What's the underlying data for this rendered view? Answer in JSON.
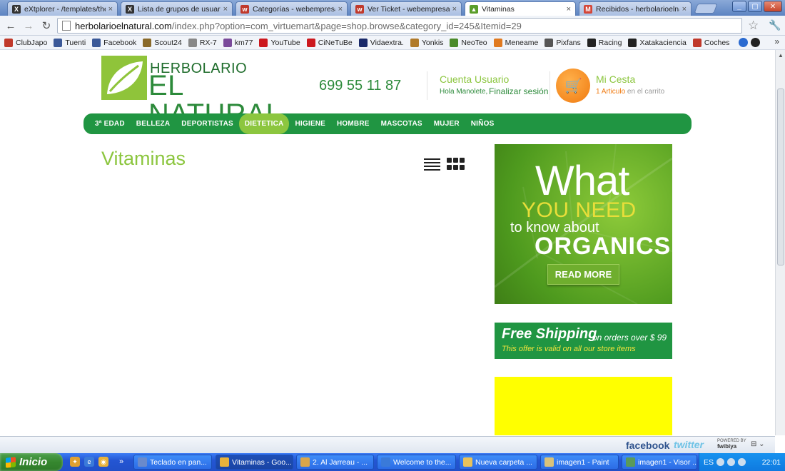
{
  "browser": {
    "tabs": [
      {
        "title": "eXtplorer - /templates/theme",
        "color": "#333333",
        "glyph": "X"
      },
      {
        "title": "Lista de grupos de usuario",
        "color": "#333333",
        "glyph": "X"
      },
      {
        "title": "Categorías - webempresa.jo",
        "color": "#c0392b",
        "glyph": "w"
      },
      {
        "title": "Ver Ticket - webempresa.co",
        "color": "#c0392b",
        "glyph": "w"
      },
      {
        "title": "Vitaminas",
        "color": "#5a9e2a",
        "glyph": "▲",
        "active": true
      },
      {
        "title": "Recibidos - herbolarioelnatur",
        "color": "#d44638",
        "glyph": "M"
      }
    ],
    "url_host": "herbolarioelnatural.com",
    "url_path": "/index.php?option=com_virtuemart&page=shop.browse&category_id=245&Itemid=29",
    "bookmarks": [
      {
        "label": "ClubJapo",
        "color": "#c0392b"
      },
      {
        "label": "Tuenti",
        "color": "#3b5998"
      },
      {
        "label": "Facebook",
        "color": "#3b5998"
      },
      {
        "label": "Scout24",
        "color": "#8a6a2a"
      },
      {
        "label": "RX-7",
        "color": "#888888"
      },
      {
        "label": "km77",
        "color": "#7a4a9a"
      },
      {
        "label": "YouTube",
        "color": "#cc181e"
      },
      {
        "label": "CiNeTuBe",
        "color": "#cc181e"
      },
      {
        "label": "Vidaextra.",
        "color": "#1a2a6a"
      },
      {
        "label": "Yonkis",
        "color": "#b07a2a"
      },
      {
        "label": "NeoTeo",
        "color": "#4a8a2a"
      },
      {
        "label": "Meneame",
        "color": "#e07a20"
      },
      {
        "label": "Pixfans",
        "color": "#555555"
      },
      {
        "label": "Racing",
        "color": "#222222"
      },
      {
        "label": "Xatakaciencia",
        "color": "#222222"
      },
      {
        "label": "Coches",
        "color": "#c0392b"
      }
    ]
  },
  "site": {
    "logo_top": "HERBOLARIO",
    "logo_bottom": "EL NATURAL",
    "phone": "699 55 11 87",
    "account_title": "Cuenta Usuario",
    "account_hello": "Hola Manolete,",
    "account_logout": "Finalizar sesión",
    "cart_title": "Mi Cesta",
    "cart_count": "1 Articulo",
    "cart_suffix": " en el carrito",
    "nav": [
      {
        "label": "3ª EDAD"
      },
      {
        "label": "BELLEZA"
      },
      {
        "label": "DEPORTISTAS"
      },
      {
        "label": "DIETETICA",
        "active": true
      },
      {
        "label": "HIGIENE"
      },
      {
        "label": "HOMBRE"
      },
      {
        "label": "MASCOTAS"
      },
      {
        "label": "MUJER"
      },
      {
        "label": "NIÑOS"
      }
    ],
    "page_title": "Vitaminas",
    "banner_organics": {
      "line1": "What",
      "line2": "YOU NEED",
      "line3": "to know about",
      "line4": "ORGANICS",
      "button": "READ MORE"
    },
    "banner_shipping": {
      "big": "Free Shipping",
      "small": "on orders over $ 99",
      "valid": "This offer is valid on all our store items"
    }
  },
  "social": {
    "facebook": "facebook",
    "twitter": "twitter",
    "powered_by": "POWERED BY",
    "brand": "fwibiya"
  },
  "taskbar": {
    "start": "Inicio",
    "buttons": [
      {
        "label": "Teclado en pan...",
        "color": "#6a8acb"
      },
      {
        "label": "Vitaminas - Goo...",
        "color": "#e8b23a",
        "active": true
      },
      {
        "label": "2. Al Jarreau - ...",
        "color": "#d9a64a"
      },
      {
        "label": "Welcome to the...",
        "color": "#3a7ad9"
      },
      {
        "label": "Nueva carpeta ...",
        "color": "#e8c25a"
      },
      {
        "label": "imagen1 - Paint",
        "color": "#d9c27a"
      },
      {
        "label": "imagen1 - Visor ...",
        "color": "#5a9a5a"
      }
    ],
    "lang": "ES",
    "clock": "22:01"
  }
}
